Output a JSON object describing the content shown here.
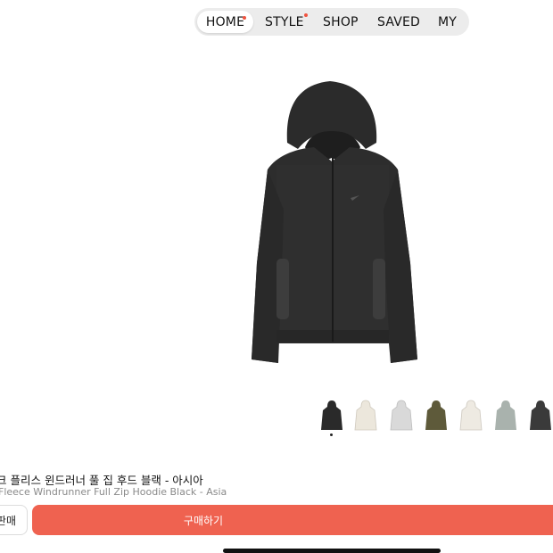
{
  "nav": {
    "items": [
      {
        "label": "HOME",
        "active": true,
        "has_dot": true
      },
      {
        "label": "STYLE",
        "active": false,
        "has_dot": true
      },
      {
        "label": "SHOP",
        "active": false,
        "has_dot": false
      },
      {
        "label": "SAVED",
        "active": false,
        "has_dot": false
      },
      {
        "label": "MY",
        "active": false,
        "has_dot": false
      }
    ],
    "dot_color": "#f0533f"
  },
  "product": {
    "image_icon": "black-zip-hoodie-image",
    "title_ko": "크 플리스 윈드러너 풀 집 후드 블랙 - 아시아",
    "title_en": "Fleece Windrunner Full Zip Hoodie Black - Asia",
    "thumbnails": [
      {
        "icon": "black-hoodie-thumbnail",
        "color": "#2a2a2a",
        "selected": true
      },
      {
        "icon": "cream-hoodie-thumbnail",
        "color": "#ece7dc",
        "selected": false
      },
      {
        "icon": "light-grey-hoodie-thumbnail",
        "color": "#d9d9d9",
        "selected": false
      },
      {
        "icon": "olive-hoodie-thumbnail",
        "color": "#5e5a3a",
        "selected": false
      },
      {
        "icon": "white-hoodie-thumbnail",
        "color": "#eeeae2",
        "selected": false
      },
      {
        "icon": "sage-grey-hoodie-thumbnail",
        "color": "#a9b2ad",
        "selected": false
      },
      {
        "icon": "charcoal-hoodie-thumbnail",
        "color": "#3a3a3a",
        "selected": false
      }
    ]
  },
  "actions": {
    "sell_label": "판매",
    "buy_label": "구매하기",
    "buy_color": "#ef6250"
  }
}
